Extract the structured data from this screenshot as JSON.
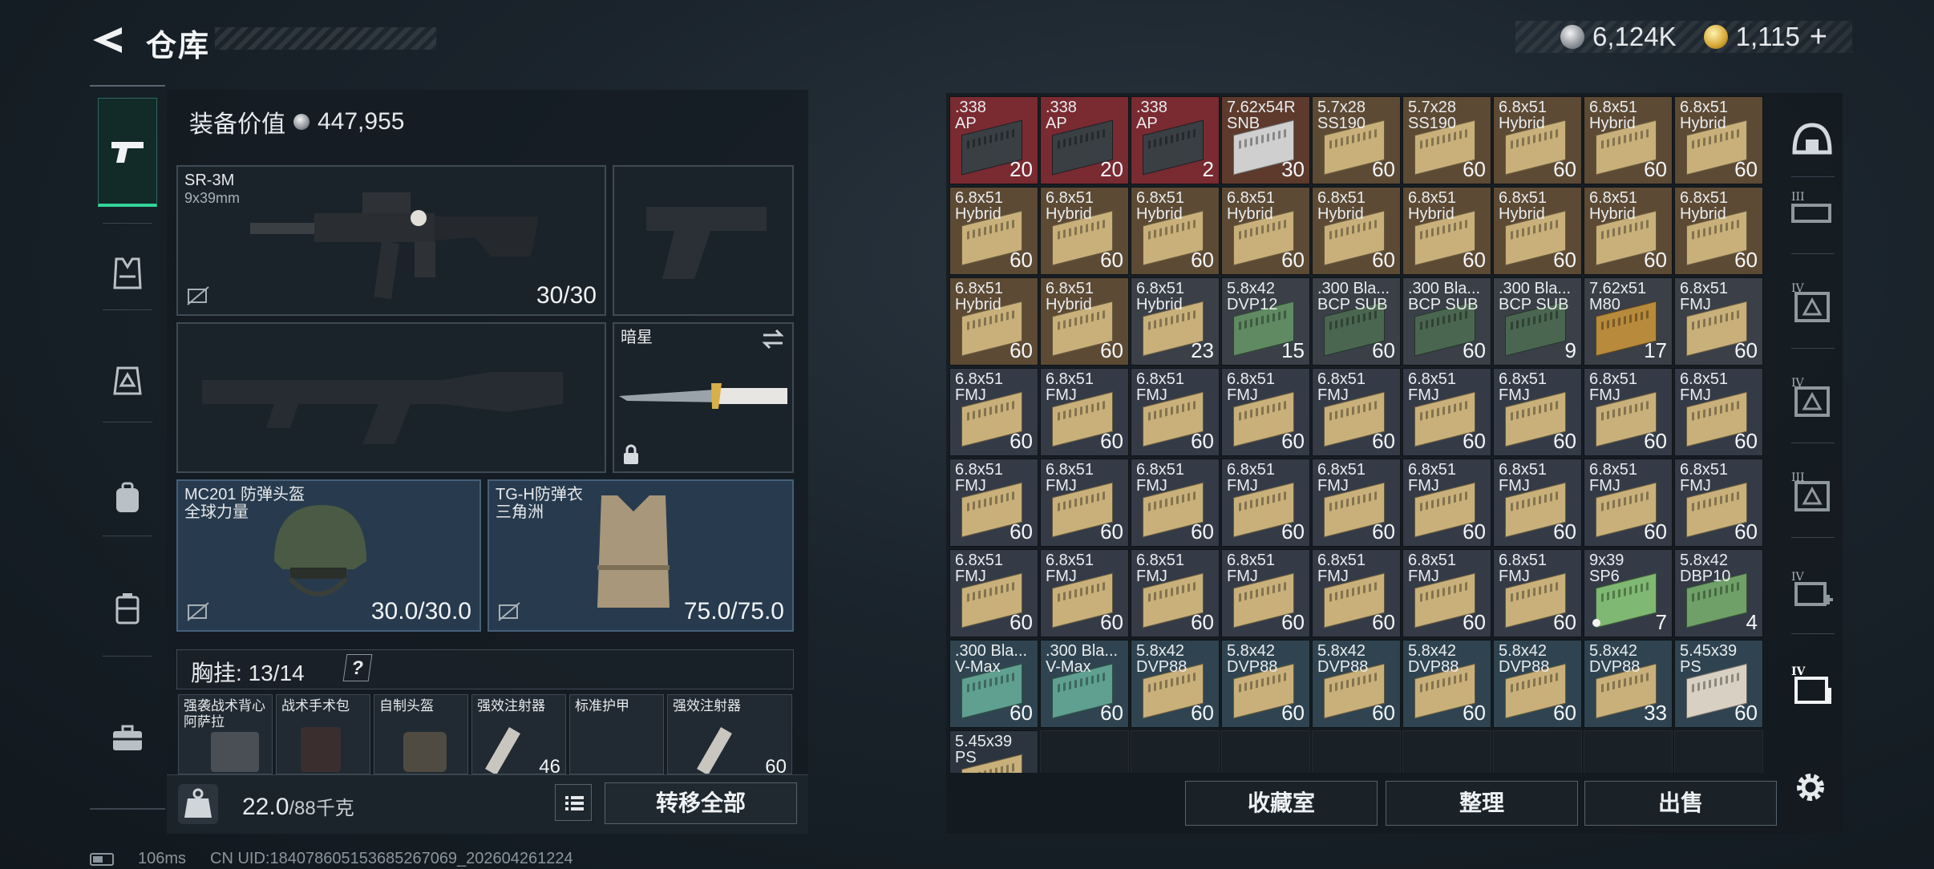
{
  "header": {
    "title": "仓库",
    "currency_silver": "6,124K",
    "currency_gold": "1,115",
    "currency_plus": "+"
  },
  "left_rail": {
    "items": [
      "pistol-icon",
      "vest-icon",
      "armor-icon",
      "backpack-icon",
      "container-icon",
      "toolbox-icon"
    ]
  },
  "equipment": {
    "value_label": "装备价值",
    "value_amount": "447,955",
    "primary_weapon": {
      "name": "SR-3M",
      "caliber": "9x39mm",
      "ammo": "30/30"
    },
    "melee": {
      "name": "暗星"
    },
    "helmet": {
      "name": "MC201 防弹头盔",
      "faction": "全球力量",
      "durability": "30.0/30.0"
    },
    "armor": {
      "name": "TG-H防弹衣",
      "faction": "三角洲",
      "durability": "75.0/75.0"
    },
    "chest_rig": {
      "label": "胸挂:",
      "capacity": "13/14",
      "help": "?"
    },
    "chest_items": [
      {
        "name": "强袭战术背心\n阿萨拉",
        "count": ""
      },
      {
        "name": "战术手术包",
        "count": ""
      },
      {
        "name": "自制头盔",
        "count": ""
      },
      {
        "name": "强效注射器",
        "count": "46"
      },
      {
        "name": "标准护甲",
        "count": ""
      },
      {
        "name": "强效注射器",
        "count": "60"
      }
    ],
    "weight_value": "22.0",
    "weight_unit": "/88千克",
    "transfer_all": "转移全部"
  },
  "stash": {
    "items": [
      {
        "name": ".338\nAP",
        "count": "20",
        "bg": "#7a2a31",
        "box": "#3a3f44"
      },
      {
        "name": ".338\nAP",
        "count": "20",
        "bg": "#7a2a31",
        "box": "#3a3f44"
      },
      {
        "name": ".338\nAP",
        "count": "2",
        "bg": "#7a2a31",
        "box": "#3a3f44"
      },
      {
        "name": "7.62x54R\nSNB",
        "count": "30",
        "bg": "#5d3a2c",
        "box": "#cfcfcf"
      },
      {
        "name": "5.7x28\nSS190",
        "count": "60",
        "bg": "#5d4a34",
        "box": "#c9b07a"
      },
      {
        "name": "5.7x28\nSS190",
        "count": "60",
        "bg": "#5d4a34",
        "box": "#c9b07a"
      },
      {
        "name": "6.8x51\nHybrid",
        "count": "60",
        "bg": "#5d4a34",
        "box": "#c9b07a"
      },
      {
        "name": "6.8x51\nHybrid",
        "count": "60",
        "bg": "#5d4a34",
        "box": "#c9b07a"
      },
      {
        "name": "6.8x51\nHybrid",
        "count": "60",
        "bg": "#5d4a34",
        "box": "#c9b07a"
      },
      {
        "name": "6.8x51\nHybrid",
        "count": "60",
        "bg": "#5d4a34",
        "box": "#c9b07a"
      },
      {
        "name": "6.8x51\nHybrid",
        "count": "60",
        "bg": "#5d4a34",
        "box": "#c9b07a"
      },
      {
        "name": "6.8x51\nHybrid",
        "count": "60",
        "bg": "#5d4a34",
        "box": "#c9b07a"
      },
      {
        "name": "6.8x51\nHybrid",
        "count": "60",
        "bg": "#5d4a34",
        "box": "#c9b07a"
      },
      {
        "name": "6.8x51\nHybrid",
        "count": "60",
        "bg": "#5d4a34",
        "box": "#c9b07a"
      },
      {
        "name": "6.8x51\nHybrid",
        "count": "60",
        "bg": "#5d4a34",
        "box": "#c9b07a"
      },
      {
        "name": "6.8x51\nHybrid",
        "count": "60",
        "bg": "#5d4a34",
        "box": "#c9b07a"
      },
      {
        "name": "6.8x51\nHybrid",
        "count": "60",
        "bg": "#5d4a34",
        "box": "#c9b07a"
      },
      {
        "name": "6.8x51\nHybrid",
        "count": "60",
        "bg": "#5d4a34",
        "box": "#c9b07a"
      },
      {
        "name": "6.8x51\nHybrid",
        "count": "60",
        "bg": "#5d4a34",
        "box": "#c9b07a"
      },
      {
        "name": "6.8x51\nHybrid",
        "count": "60",
        "bg": "#5d4a34",
        "box": "#c9b07a"
      },
      {
        "name": "6.8x51\nHybrid",
        "count": "23",
        "bg": "#3a3f48",
        "box": "#c9b07a"
      },
      {
        "name": "5.8x42\nDVP12",
        "count": "15",
        "bg": "#3a3f48",
        "box": "#5f8a62"
      },
      {
        "name": ".300 Bla...\nBCP SUB",
        "count": "60",
        "bg": "#3a3f48",
        "box": "#4a6650"
      },
      {
        "name": ".300 Bla...\nBCP SUB",
        "count": "60",
        "bg": "#3a3f48",
        "box": "#4a6650"
      },
      {
        "name": ".300 Bla...\nBCP SUB",
        "count": "9",
        "bg": "#3a3f48",
        "box": "#4a6650"
      },
      {
        "name": "7.62x51\nM80",
        "count": "17",
        "bg": "#3a3f48",
        "box": "#b88a3c"
      },
      {
        "name": "6.8x51\nFMJ",
        "count": "60",
        "bg": "#3a3f48",
        "box": "#c9b07a"
      },
      {
        "name": "6.8x51\nFMJ",
        "count": "60",
        "bg": "#343b47",
        "box": "#c9b07a"
      },
      {
        "name": "6.8x51\nFMJ",
        "count": "60",
        "bg": "#343b47",
        "box": "#c9b07a"
      },
      {
        "name": "6.8x51\nFMJ",
        "count": "60",
        "bg": "#343b47",
        "box": "#c9b07a"
      },
      {
        "name": "6.8x51\nFMJ",
        "count": "60",
        "bg": "#343b47",
        "box": "#c9b07a"
      },
      {
        "name": "6.8x51\nFMJ",
        "count": "60",
        "bg": "#343b47",
        "box": "#c9b07a"
      },
      {
        "name": "6.8x51\nFMJ",
        "count": "60",
        "bg": "#343b47",
        "box": "#c9b07a"
      },
      {
        "name": "6.8x51\nFMJ",
        "count": "60",
        "bg": "#343b47",
        "box": "#c9b07a"
      },
      {
        "name": "6.8x51\nFMJ",
        "count": "60",
        "bg": "#343b47",
        "box": "#c9b07a"
      },
      {
        "name": "6.8x51\nFMJ",
        "count": "60",
        "bg": "#343b47",
        "box": "#c9b07a"
      },
      {
        "name": "6.8x51\nFMJ",
        "count": "60",
        "bg": "#343b47",
        "box": "#c9b07a"
      },
      {
        "name": "6.8x51\nFMJ",
        "count": "60",
        "bg": "#343b47",
        "box": "#c9b07a"
      },
      {
        "name": "6.8x51\nFMJ",
        "count": "60",
        "bg": "#343b47",
        "box": "#c9b07a"
      },
      {
        "name": "6.8x51\nFMJ",
        "count": "60",
        "bg": "#343b47",
        "box": "#c9b07a"
      },
      {
        "name": "6.8x51\nFMJ",
        "count": "60",
        "bg": "#343b47",
        "box": "#c9b07a"
      },
      {
        "name": "6.8x51\nFMJ",
        "count": "60",
        "bg": "#343b47",
        "box": "#c9b07a"
      },
      {
        "name": "6.8x51\nFMJ",
        "count": "60",
        "bg": "#343b47",
        "box": "#c9b07a"
      },
      {
        "name": "6.8x51\nFMJ",
        "count": "60",
        "bg": "#343b47",
        "box": "#c9b07a"
      },
      {
        "name": "6.8x51\nFMJ",
        "count": "60",
        "bg": "#343b47",
        "box": "#c9b07a"
      },
      {
        "name": "6.8x51\nFMJ",
        "count": "60",
        "bg": "#343b47",
        "box": "#c9b07a"
      },
      {
        "name": "6.8x51\nFMJ",
        "count": "60",
        "bg": "#343b47",
        "box": "#c9b07a"
      },
      {
        "name": "6.8x51\nFMJ",
        "count": "60",
        "bg": "#343b47",
        "box": "#c9b07a"
      },
      {
        "name": "6.8x51\nFMJ",
        "count": "60",
        "bg": "#343b47",
        "box": "#c9b07a"
      },
      {
        "name": "6.8x51\nFMJ",
        "count": "60",
        "bg": "#343b47",
        "box": "#c9b07a"
      },
      {
        "name": "6.8x51\nFMJ",
        "count": "60",
        "bg": "#343b47",
        "box": "#c9b07a"
      },
      {
        "name": "6.8x51\nFMJ",
        "count": "60",
        "bg": "#343b47",
        "box": "#c9b07a"
      },
      {
        "name": "9x39\nSP6",
        "count": "7",
        "bg": "#343b47",
        "box": "#7fb872",
        "dot": true
      },
      {
        "name": "5.8x42\nDBP10",
        "count": "4",
        "bg": "#343b47",
        "box": "#6fa068"
      },
      {
        "name": ".300 Bla...\nV-Max",
        "count": "60",
        "bg": "#2f4450",
        "box": "#5fa090"
      },
      {
        "name": ".300 Bla...\nV-Max",
        "count": "60",
        "bg": "#2f4450",
        "box": "#5fa090"
      },
      {
        "name": "5.8x42\nDVP88",
        "count": "60",
        "bg": "#2f4450",
        "box": "#c9b07a"
      },
      {
        "name": "5.8x42\nDVP88",
        "count": "60",
        "bg": "#2f4450",
        "box": "#c9b07a"
      },
      {
        "name": "5.8x42\nDVP88",
        "count": "60",
        "bg": "#2f4450",
        "box": "#c9b07a"
      },
      {
        "name": "5.8x42\nDVP88",
        "count": "60",
        "bg": "#2f4450",
        "box": "#c9b07a"
      },
      {
        "name": "5.8x42\nDVP88",
        "count": "60",
        "bg": "#2f4450",
        "box": "#c9b07a"
      },
      {
        "name": "5.8x42\nDVP88",
        "count": "33",
        "bg": "#2f4450",
        "box": "#c9b07a"
      },
      {
        "name": "5.45x39\nPS",
        "count": "60",
        "bg": "#2f4450",
        "box": "#d8d0c2"
      },
      {
        "name": "5.45x39\nPS",
        "count": "",
        "bg": "#2c353f",
        "box": "#c9b07a"
      }
    ],
    "btn_collection": "收藏室",
    "btn_sort": "整理",
    "btn_sell": "出售"
  },
  "right_rail": {
    "filters": [
      "helmet-filter-icon",
      "armor-III-icon",
      "armor-IV-icon",
      "armor-IV-icon",
      "armor-III-icon",
      "med-IV-icon",
      "ammo-IV-icon"
    ],
    "roman_labels": [
      "III",
      "IV",
      "IV",
      "III",
      "IV",
      "IV"
    ]
  },
  "status": {
    "ping": "106ms",
    "uid": "CN UID:18407860515368526706​9_202604261224"
  }
}
